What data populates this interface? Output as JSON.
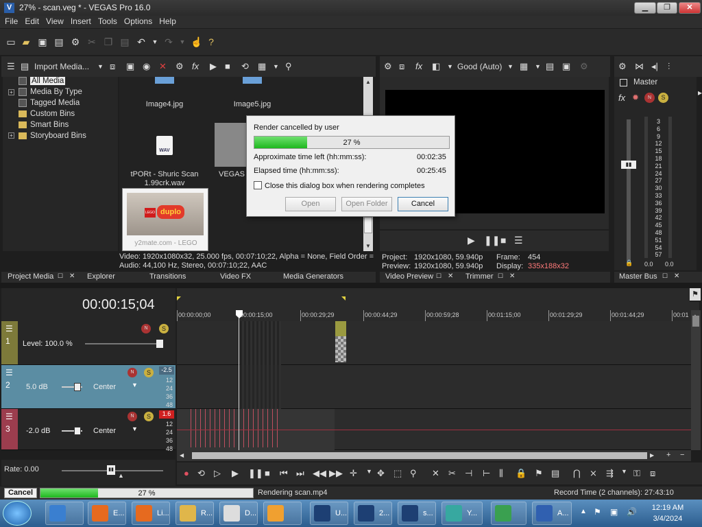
{
  "window": {
    "title": "27% - scan.veg * - VEGAS Pro 16.0",
    "logo": "V"
  },
  "menu": [
    "File",
    "Edit",
    "View",
    "Insert",
    "Tools",
    "Options",
    "Help"
  ],
  "media_toolbar": {
    "import_label": "Import Media..."
  },
  "tree": [
    "All Media",
    "Media By Type",
    "Tagged Media",
    "Custom Bins",
    "Smart Bins",
    "Storyboard Bins"
  ],
  "thumbs": [
    {
      "caption": "Image4.jpg"
    },
    {
      "caption": "Image5.jpg"
    },
    {
      "caption": "tPORt - Shuric Scan 1.99crk.wav"
    },
    {
      "caption": "VEGAS S"
    },
    {
      "caption": "y2mate.com - LEGO",
      "thumb_text": "duplo",
      "thumb_brand": "LEGO"
    }
  ],
  "wav_label": "WAV",
  "media_info": {
    "video": "Video: 1920x1080x32, 25.000 fps, 00:07:10;22, Alpha = None, Field Order =",
    "audio": "Audio: 44,100 Hz, Stereo, 00:07:10;22, AAC"
  },
  "left_tabs": [
    "Project Media",
    "Explorer",
    "Transitions",
    "Video FX",
    "Media Generators"
  ],
  "preview": {
    "quality": "Good (Auto)",
    "project_label": "Project:",
    "project_value": "1920x1080, 59.940p",
    "preview_label": "Preview:",
    "preview_value": "1920x1080, 59.940p",
    "frame_label": "Frame:",
    "frame_value": "454",
    "display_label": "Display:",
    "display_value": "335x188x32",
    "tabs": [
      "Video Preview",
      "Trimmer"
    ]
  },
  "master": {
    "label": "Master",
    "scale": [
      "3",
      "6",
      "9",
      "12",
      "15",
      "18",
      "21",
      "24",
      "27",
      "30",
      "33",
      "36",
      "39",
      "42",
      "45",
      "48",
      "51",
      "54",
      "57"
    ],
    "left_value": "0.0",
    "right_value": "0.0",
    "tab": "Master Bus"
  },
  "dialog": {
    "title": "Render cancelled by user",
    "progress_text": "27 %",
    "progress": 0.27,
    "time_left_label": "Approximate time left (hh:mm:ss):",
    "time_left": "00:02:35",
    "elapsed_label": "Elapsed time (hh:mm:ss):",
    "elapsed": "00:25:45",
    "checkbox_label": "Close this dialog box when rendering completes",
    "btn_open": "Open",
    "btn_open_folder": "Open Folder",
    "btn_cancel": "Cancel"
  },
  "timeline": {
    "timecode": "00:00:15;04",
    "ruler": [
      "00:00:00;00",
      "00:00:15;00",
      "00:00:29;29",
      "00:00:44;29",
      "00:00:59;28",
      "00:01:15;00",
      "00:01:29;29",
      "00:01:44;29",
      "00:01"
    ],
    "tracks": [
      {
        "num": "1",
        "level": "Level: 100.0 %",
        "color": "#7d7a3a"
      },
      {
        "num": "2",
        "level": "5.0 dB",
        "pan": "Center",
        "peak": "-2.5",
        "color": "#5b8da3"
      },
      {
        "num": "3",
        "level": "-2.0 dB",
        "pan": "Center",
        "peak": "1.6",
        "color": "#9c3d4e"
      }
    ],
    "meter_scale": [
      "12",
      "24",
      "36",
      "48"
    ],
    "rate": "Rate: 0.00"
  },
  "status": {
    "cancel_label": "Cancel",
    "progress_text": "27 %",
    "progress": 0.27,
    "rendering": "Rendering scan.mp4",
    "record_time": "Record Time (2 channels): 27:43:10"
  },
  "taskbar": {
    "items": [
      {
        "label": "",
        "icon": "ie-icon",
        "color": "#3a7fd0"
      },
      {
        "label": "E...",
        "icon": "firefox-icon",
        "color": "#e66a1f"
      },
      {
        "label": "Li...",
        "icon": "firefox-icon",
        "color": "#e66a1f"
      },
      {
        "label": "R...",
        "icon": "folder-icon",
        "color": "#e0b64a"
      },
      {
        "label": "D...",
        "icon": "document-icon",
        "color": "#dddddd"
      },
      {
        "label": "",
        "icon": "media-icon",
        "color": "#f0a030"
      },
      {
        "label": "U...",
        "icon": "vegas-icon",
        "color": "#1d3f73"
      },
      {
        "label": "2...",
        "icon": "vegas-icon",
        "color": "#1d3f73"
      },
      {
        "label": "s...",
        "icon": "vegas-icon",
        "color": "#1d3f73"
      },
      {
        "label": "Y...",
        "icon": "globe-icon",
        "color": "#37a8a0"
      },
      {
        "label": "",
        "icon": "download-icon",
        "color": "#3aa050"
      },
      {
        "label": "A...",
        "icon": "app-icon",
        "color": "#3060b0"
      }
    ],
    "time": "12:19 AM",
    "date": "3/4/2024"
  }
}
